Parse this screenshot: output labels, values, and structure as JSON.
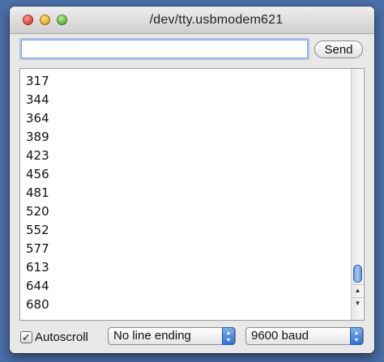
{
  "window": {
    "title": "/dev/tty.usbmodem621"
  },
  "send_bar": {
    "input_value": "",
    "input_placeholder": "",
    "send_label": "Send"
  },
  "output": {
    "lines": [
      "317",
      "344",
      "364",
      "389",
      "423",
      "456",
      "481",
      "520",
      "552",
      "577",
      "613",
      "644",
      "680"
    ]
  },
  "bottom": {
    "autoscroll_label": "Autoscroll",
    "autoscroll_checked": true,
    "line_ending_selected": "No line ending",
    "baud_selected": "9600 baud"
  },
  "colors": {
    "accent": "#3a78d6",
    "desktop": "#4a6ea8"
  }
}
